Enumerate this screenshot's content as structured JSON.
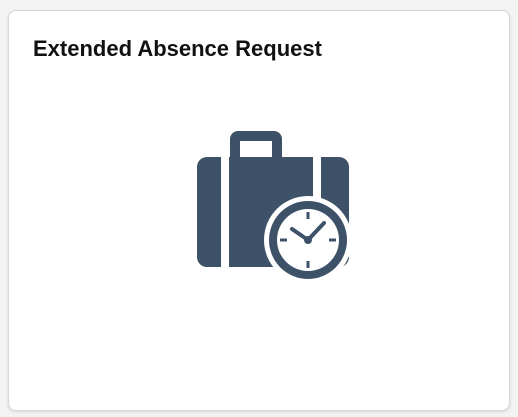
{
  "tile": {
    "title": "Extended Absence Request",
    "icon": "briefcase-clock-icon"
  },
  "colors": {
    "icon": "#3d5268",
    "icon_accent": "#ffffff",
    "tile_background": "#ffffff",
    "page_background": "#f3f3f3",
    "title_text": "#111111"
  }
}
